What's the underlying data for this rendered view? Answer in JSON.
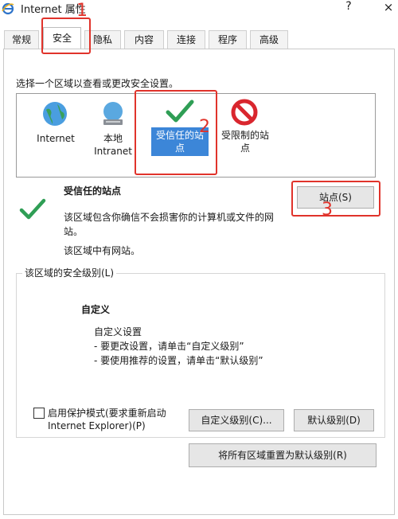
{
  "window": {
    "title": "Internet 属性",
    "help": "?",
    "close": "×"
  },
  "tabs": [
    {
      "label": "常规"
    },
    {
      "label": "安全"
    },
    {
      "label": "隐私"
    },
    {
      "label": "内容"
    },
    {
      "label": "连接"
    },
    {
      "label": "程序"
    },
    {
      "label": "高级"
    }
  ],
  "zone_prompt": "选择一个区域以查看或更改安全设置。",
  "zones": [
    {
      "label_line1": "Internet",
      "label_line2": ""
    },
    {
      "label_line1": "本地",
      "label_line2": "Intranet"
    },
    {
      "label_line1": "受信任的站",
      "label_line2": "点"
    },
    {
      "label_line1": "受限制的站",
      "label_line2": "点"
    }
  ],
  "zone_info": {
    "title": "受信任的站点",
    "desc_line1": "该区域包含你确信不会损害你的计算机或文件的网",
    "desc_line2": "站。",
    "has_sites": "该区域中有网站。"
  },
  "sites_button": "站点(S)",
  "security_level": {
    "group_title": "该区域的安全级别(L)",
    "level_name": "自定义",
    "custom_settings": "自定义设置",
    "bullet1": "- 要更改设置，请单击“自定义级别”",
    "bullet2": "- 要使用推荐的设置，请单击“默认级别”"
  },
  "protected_mode": {
    "line1": "启用保护模式(要求重新启动",
    "line2": "Internet Explorer)(P)",
    "checked": false
  },
  "buttons": {
    "custom_level": "自定义级别(C)...",
    "default_level": "默认级别(D)",
    "reset_all": "将所有区域重置为默认级别(R)"
  },
  "annotations": {
    "n1": "1",
    "n2": "2",
    "n3": "3"
  },
  "colors": {
    "accent": "#3c86d8",
    "annotation_red": "#e0332b",
    "check_green": "#2f9e55",
    "restricted_red": "#d9262e"
  }
}
